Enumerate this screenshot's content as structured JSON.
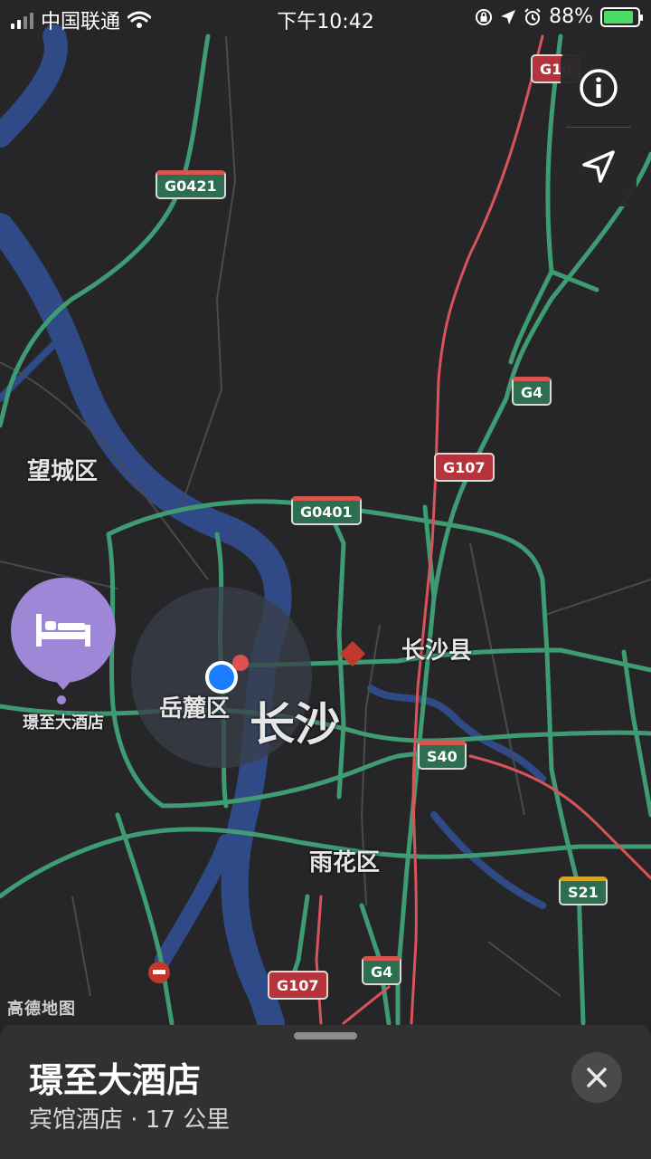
{
  "status_bar": {
    "carrier": "中国联通",
    "time": "下午10:42",
    "battery": "88%",
    "battery_level": 0.88,
    "icons": [
      "signal-icon",
      "wifi-icon",
      "screen-lock-icon",
      "location-arrow-icon",
      "alarm-icon",
      "battery-charging-icon"
    ]
  },
  "map": {
    "districts": {
      "wangcheng": "望城区",
      "yuelu": "岳麓区",
      "changsha": "长沙",
      "changsha_county": "长沙县",
      "yuhua": "雨花区"
    },
    "road_shields": {
      "g107_top": "G10",
      "g0421": "G0421",
      "g4_north": "G4",
      "g107_mid": "G107",
      "g0401": "G0401",
      "s40": "S40",
      "s21": "S21",
      "g4_south": "G4",
      "g107_south": "G107"
    },
    "poi": {
      "label": "璟至大酒店",
      "icon": "bed-icon"
    },
    "watermark": "高德地图"
  },
  "controls": {
    "info_icon": "info-icon",
    "locate_icon": "location-arrow-icon"
  },
  "sheet": {
    "title": "璟至大酒店",
    "subtitle": "宾馆酒店 · 17 公里",
    "close_icon": "close-icon"
  },
  "colors": {
    "background": "#262628",
    "road_green": "#3e9b72",
    "road_red": "#d9535a",
    "river": "#2f4a86",
    "poi_purple": "#9d87d6",
    "location_blue": "#1a7cff"
  }
}
